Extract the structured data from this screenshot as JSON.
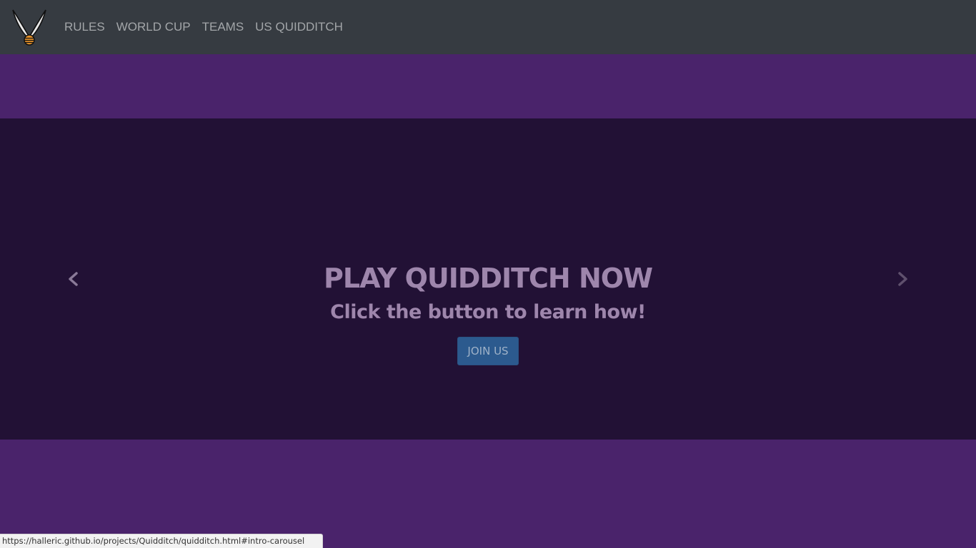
{
  "nav": {
    "logo_icon": "golden-snitch-icon",
    "links": [
      {
        "label": "RULES"
      },
      {
        "label": "WORLD CUP"
      },
      {
        "label": "TEAMS"
      },
      {
        "label": "US QUIDDITCH"
      }
    ]
  },
  "carousel": {
    "headline": "PLAY QUIDDITCH NOW",
    "subhead": "Click the button to learn how!",
    "button_label": "JOIN US",
    "prev_icon": "chevron-left-icon",
    "next_icon": "chevron-right-icon"
  },
  "colors": {
    "navbar": "#363b41",
    "band": "#4a236b",
    "carousel": "#221135",
    "button": "#2c5a8e"
  },
  "statusbar": {
    "url": "https://halleric.github.io/projects/Quidditch/quidditch.html#intro-carousel"
  }
}
